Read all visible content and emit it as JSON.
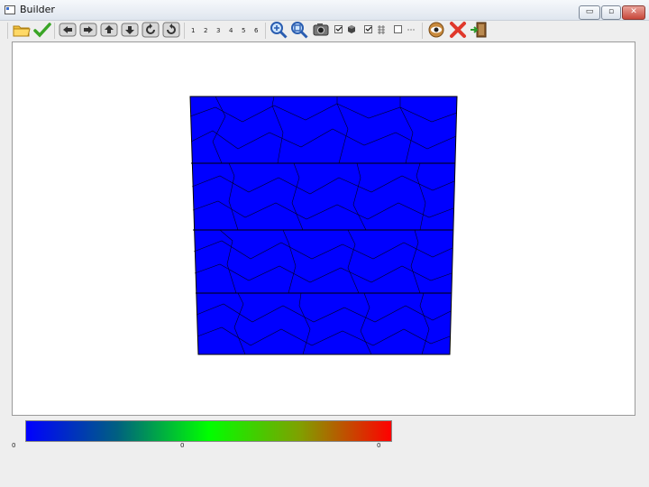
{
  "window": {
    "title": "Builder"
  },
  "window_buttons": {
    "minimize": "▭",
    "restore": "▫",
    "close": "✕"
  },
  "toolbar": {
    "buttons": [
      {
        "name": "open-folder-icon"
      },
      {
        "name": "apply-check-icon"
      },
      {
        "name": "view-left-icon"
      },
      {
        "name": "view-right-icon"
      },
      {
        "name": "view-up-icon"
      },
      {
        "name": "view-down-icon"
      },
      {
        "name": "rotate-ccw-icon"
      },
      {
        "name": "rotate-cw-icon"
      },
      {
        "name": "zoom-in-icon"
      },
      {
        "name": "zoom-fit-icon"
      },
      {
        "name": "camera-icon"
      },
      {
        "name": "eye-icon"
      },
      {
        "name": "delete-icon"
      },
      {
        "name": "exit-icon"
      }
    ],
    "numbers": [
      "1",
      "2",
      "3",
      "4",
      "5",
      "6"
    ],
    "toggles": [
      {
        "checked": true,
        "icon": "cube-icon"
      },
      {
        "checked": true,
        "icon": "grid-icon"
      },
      {
        "checked": false,
        "icon": "dash-icon"
      }
    ]
  },
  "mesh": {
    "fill": "#0000ff",
    "edge": "#000000",
    "layers": 4
  },
  "colorbar": {
    "stops": [
      "#0000ff",
      "#006080",
      "#00ff00",
      "#80a000",
      "#ff0000"
    ],
    "labels": {
      "min": "0",
      "mid": "0",
      "max": "0"
    }
  }
}
